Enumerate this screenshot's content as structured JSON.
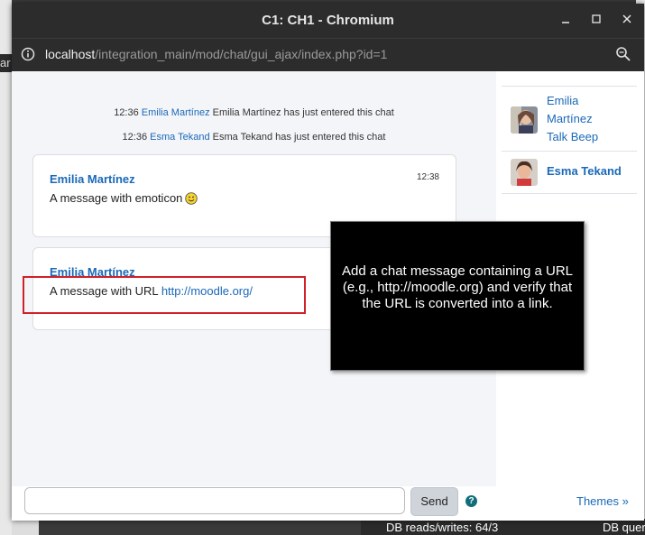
{
  "window": {
    "title": "C1: CH1 - Chromium",
    "url_host": "localhost",
    "url_path": "/integration_main/mod/chat/gui_ajax/index.php?id=1"
  },
  "background": {
    "left_fragment": "ar",
    "db_reads": "DB reads/writes: 64/3",
    "db_queries": "DB quer"
  },
  "system_messages": [
    {
      "time": "12:36",
      "user": "Emilia Martínez",
      "text": "Emilia Martínez has just entered this chat"
    },
    {
      "time": "12:36",
      "user": "Esma Tekand",
      "text": "Esma Tekand has just entered this chat"
    }
  ],
  "messages": [
    {
      "author": "Emilia Martínez",
      "time": "12:38",
      "text": "A message with emoticon",
      "emoticon": "smiley-icon"
    },
    {
      "author": "Emilia Martínez",
      "time": "",
      "text": "A message with URL",
      "link": "http://moodle.org/"
    }
  ],
  "users": [
    {
      "name": "Emilia Martínez",
      "status": "Talk Beep"
    },
    {
      "name": "Esma Tekand"
    }
  ],
  "tooltip": {
    "text": "Add a chat message containing a URL (e.g., http://moodle.org) and verify that the URL is converted into a link."
  },
  "input": {
    "send_label": "Send",
    "help_symbol": "?",
    "themes_label": "Themes »"
  },
  "colors": {
    "link": "#1a69b8",
    "highlight": "#d0202a",
    "titlebar": "#2c2c2c"
  }
}
